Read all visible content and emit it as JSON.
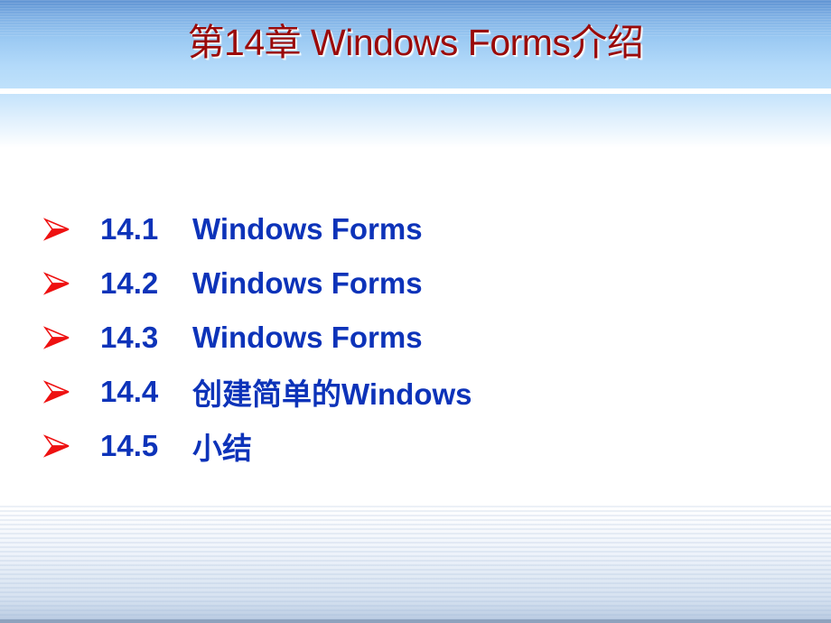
{
  "slide": {
    "title": "第14章  Windows Forms介绍",
    "colors": {
      "title": "#9a0a0a",
      "items": "#0d33b9",
      "bullet": "#ee1111"
    },
    "bullet_icon": "arrowhead-bullet-icon",
    "items": [
      {
        "number": "14.1",
        "text": "Windows Forms"
      },
      {
        "number": "14.2",
        "text": "Windows Forms"
      },
      {
        "number": "14.3",
        "text": "Windows Forms"
      },
      {
        "number": "14.4",
        "text": "创建简单的Windows"
      },
      {
        "number": "14.5",
        "text": "小结"
      }
    ]
  }
}
